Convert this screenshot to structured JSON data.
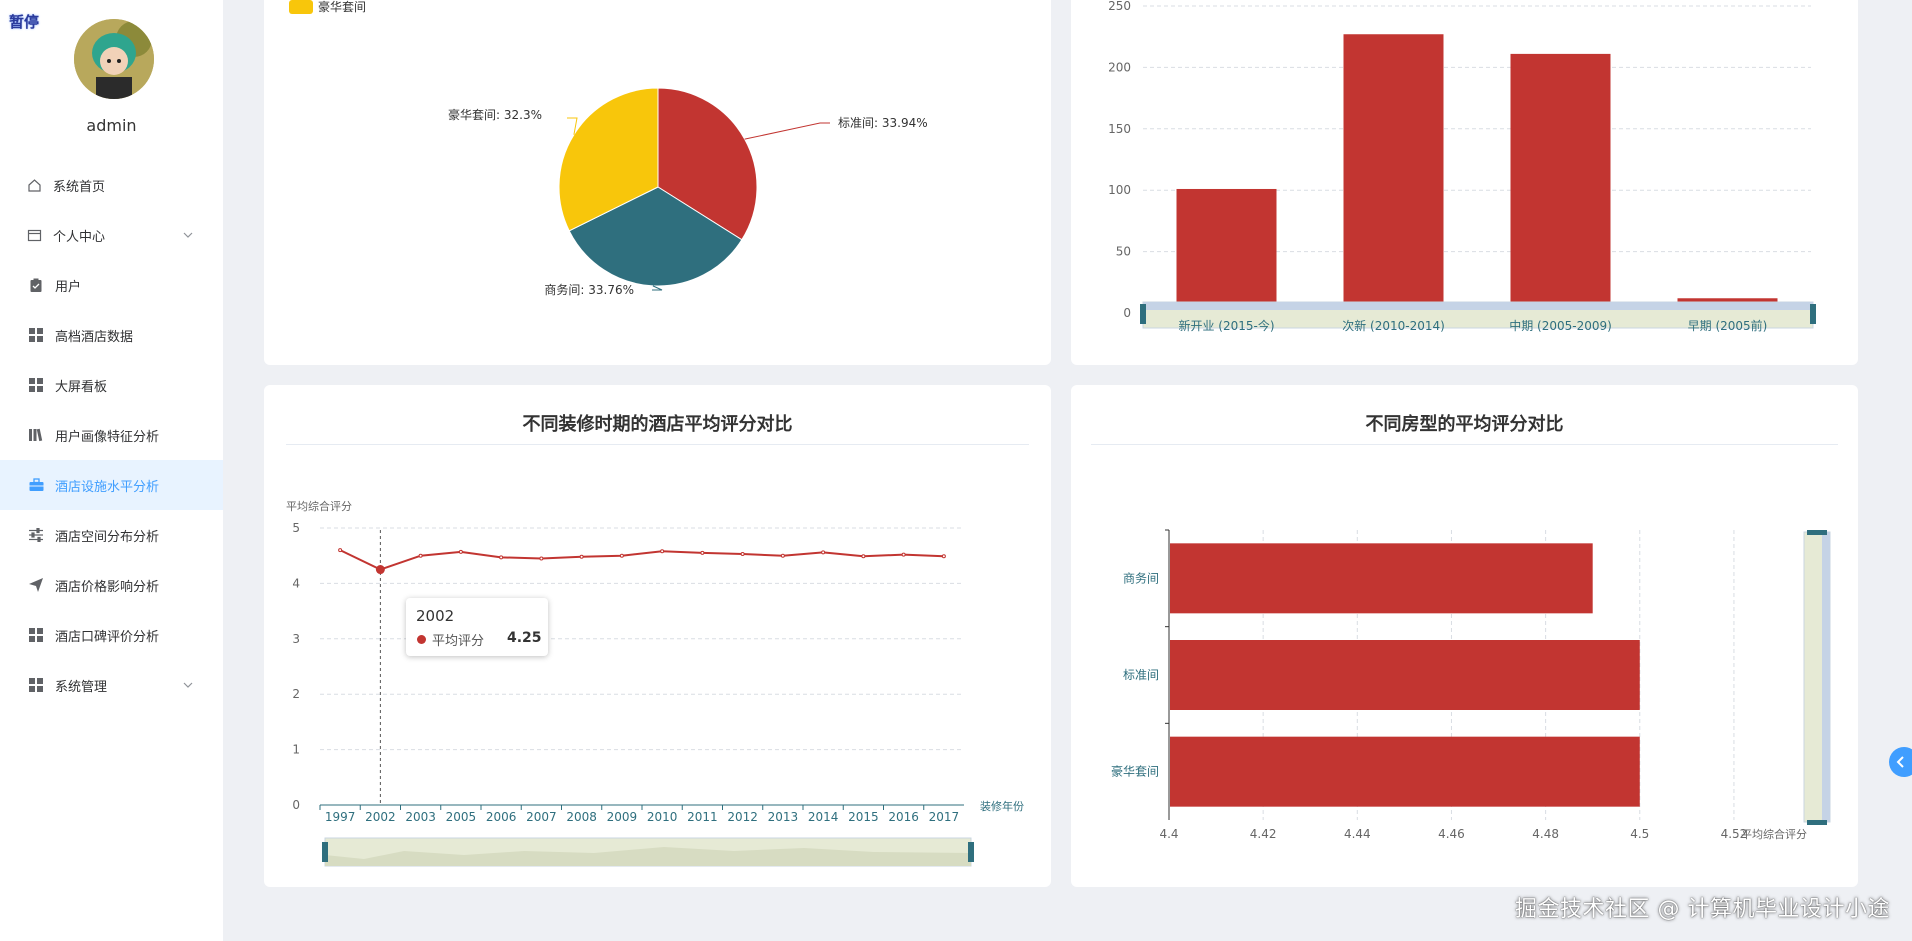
{
  "sidebar": {
    "pause_tag": "暂停",
    "username": "admin",
    "items": [
      {
        "label": "系统首页",
        "icon": "home-icon",
        "has_arrow": false
      },
      {
        "label": "个人中心",
        "icon": "profile-icon",
        "has_arrow": true
      },
      {
        "label": "用户",
        "icon": "clipboard-icon",
        "has_arrow": false
      },
      {
        "label": "高档酒店数据",
        "icon": "grid-icon",
        "has_arrow": false
      },
      {
        "label": "大屏看板",
        "icon": "grid-icon",
        "has_arrow": false
      },
      {
        "label": "用户画像特征分析",
        "icon": "bars-icon",
        "has_arrow": false
      },
      {
        "label": "酒店设施水平分析",
        "icon": "briefcase-icon",
        "has_arrow": false,
        "active": true
      },
      {
        "label": "酒店空间分布分析",
        "icon": "sliders-icon",
        "has_arrow": false
      },
      {
        "label": "酒店价格影响分析",
        "icon": "send-icon",
        "has_arrow": false
      },
      {
        "label": "酒店口碑评价分析",
        "icon": "grid-icon",
        "has_arrow": false
      },
      {
        "label": "系统管理",
        "icon": "grid-icon",
        "has_arrow": true
      }
    ]
  },
  "colors": {
    "red": "#c23531",
    "teal": "#2f6f7e",
    "yellow": "#f8c60b",
    "active": "#409eff"
  },
  "watermark": "掘金技术社区 @ 计算机毕业设计小途",
  "chart_data": [
    {
      "type": "pie",
      "legend": [
        "豪华套间"
      ],
      "slices": [
        {
          "name": "标准间",
          "percent": 33.94,
          "label": "标准间: 33.94%"
        },
        {
          "name": "商务间",
          "percent": 33.76,
          "label": "商务间: 33.76%"
        },
        {
          "name": "豪华套间",
          "percent": 32.3,
          "label": "豪华套间: 32.3%"
        }
      ]
    },
    {
      "type": "bar",
      "categories": [
        "新开业 (2015-今)",
        "次新 (2010-2014)",
        "中期 (2005-2009)",
        "早期 (2005前)"
      ],
      "values": [
        101,
        227,
        211,
        12
      ],
      "ylim": [
        0,
        250
      ],
      "yticks": [
        0,
        50,
        100,
        150,
        200,
        250
      ],
      "grid": true,
      "datazoom": "bottom"
    },
    {
      "type": "line",
      "title": "不同装修时期的酒店平均评分对比",
      "ylabel": "平均综合评分",
      "xlabel": "装修年份",
      "x": [
        "1997",
        "2002",
        "2003",
        "2005",
        "2006",
        "2007",
        "2008",
        "2009",
        "2010",
        "2011",
        "2012",
        "2013",
        "2014",
        "2015",
        "2016",
        "2017"
      ],
      "series": [
        {
          "name": "平均评分",
          "values": [
            4.6,
            4.25,
            4.5,
            4.57,
            4.47,
            4.45,
            4.48,
            4.5,
            4.58,
            4.55,
            4.53,
            4.5,
            4.56,
            4.49,
            4.52,
            4.49
          ]
        }
      ],
      "ylim": [
        0,
        5
      ],
      "yticks": [
        0,
        1,
        2,
        3,
        4,
        5
      ],
      "grid": true,
      "datazoom": "bottom",
      "tooltip": {
        "title": "2002",
        "name": "平均评分",
        "value": "4.25"
      }
    },
    {
      "type": "bar",
      "orientation": "horizontal",
      "title": "不同房型的平均评分对比",
      "categories": [
        "商务间",
        "标准间",
        "豪华套间"
      ],
      "values": [
        4.49,
        4.5,
        4.5
      ],
      "xlim": [
        4.4,
        4.53
      ],
      "xticks": [
        "4.4",
        "4.42",
        "4.44",
        "4.46",
        "4.48",
        "4.5",
        "4.52"
      ],
      "xlabel": "平均综合评分",
      "grid": true,
      "datazoom": "right"
    }
  ]
}
